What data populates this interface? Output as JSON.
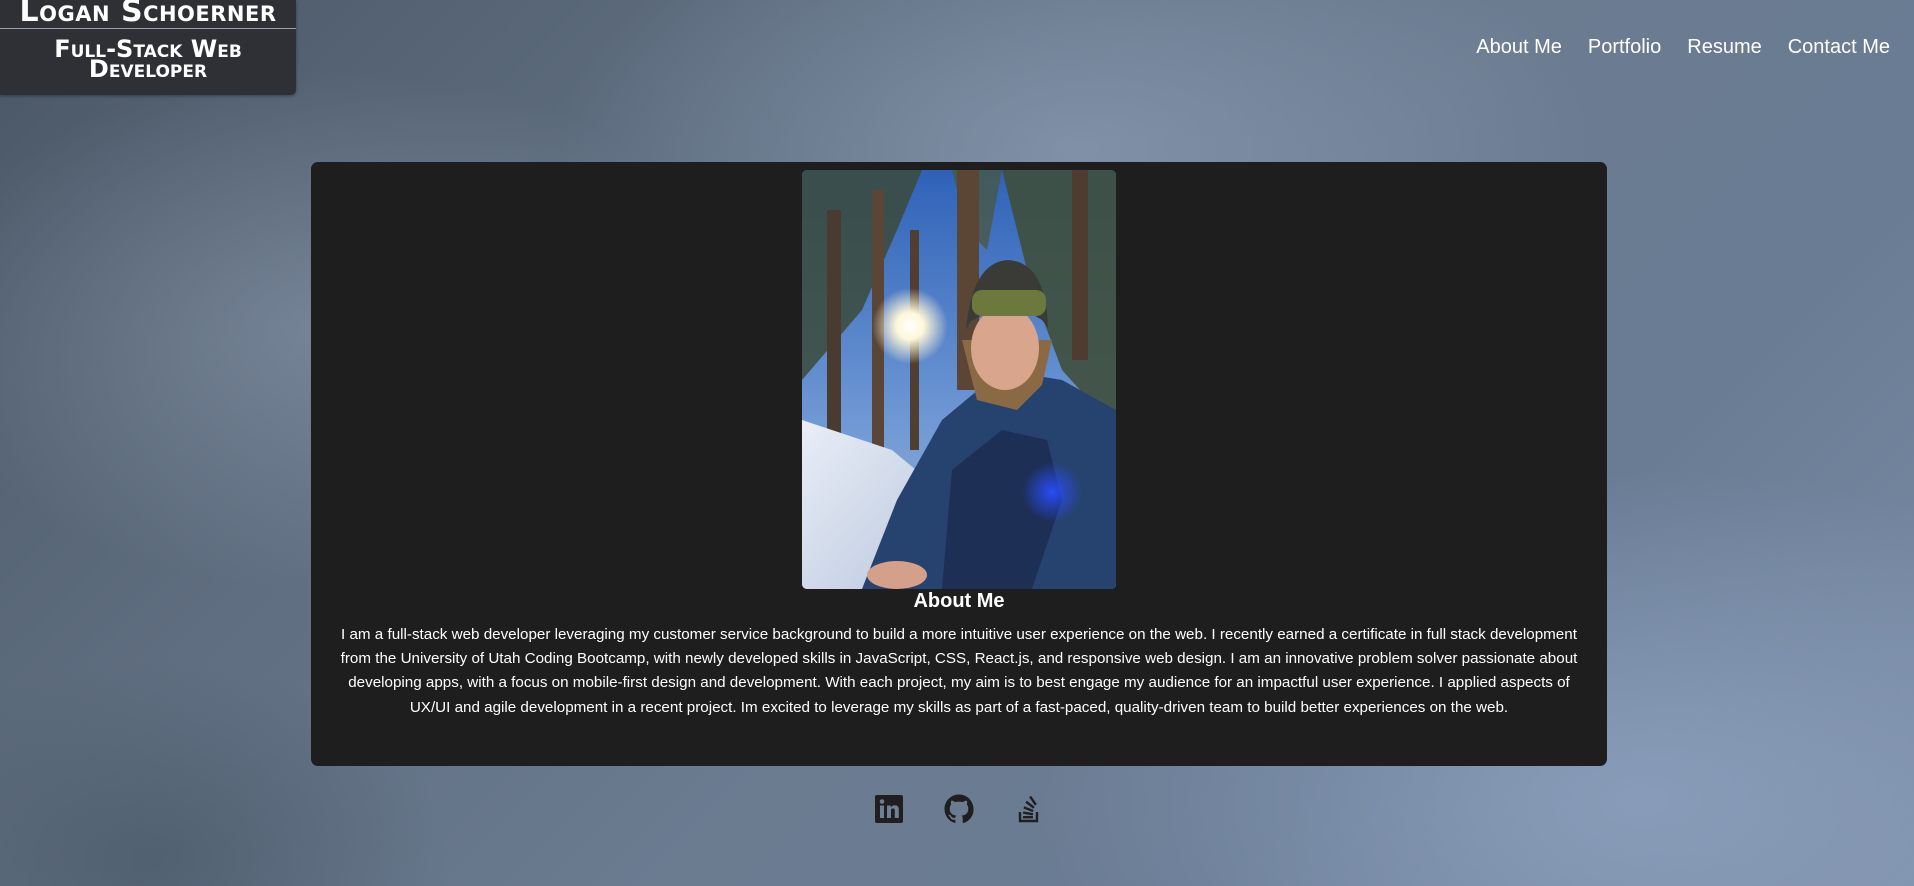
{
  "header": {
    "name": "Logan Schoerner",
    "title": "Full-Stack Web Developer"
  },
  "nav": {
    "items": [
      {
        "label": "About Me"
      },
      {
        "label": "Portfolio"
      },
      {
        "label": "Resume"
      },
      {
        "label": "Contact Me"
      }
    ]
  },
  "about": {
    "heading": "About Me",
    "photo_icon": "profile-photo",
    "body": "I am a full-stack web developer leveraging my customer service background to build a more intuitive user experience on the web. I recently earned a certificate in full stack development from the University of Utah Coding Bootcamp, with newly developed skills in JavaScript, CSS, React.js, and responsive web design. I am an innovative problem solver passionate about developing apps, with a focus on mobile-first design and development. With each project, my aim is to best engage my audience for an impactful user experience. I applied aspects of UX/UI and agile development in a recent project. Im excited to leverage my skills as part of a fast-paced, quality-driven team to build better experiences on the web."
  },
  "footer": {
    "icons": [
      "linkedin-icon",
      "github-icon",
      "stack-overflow-icon"
    ]
  },
  "colors": {
    "card_background": "#1e1e1e",
    "brand_background": "#2e3036",
    "icon_color": "#1f1f1f",
    "text": "#ffffff"
  }
}
